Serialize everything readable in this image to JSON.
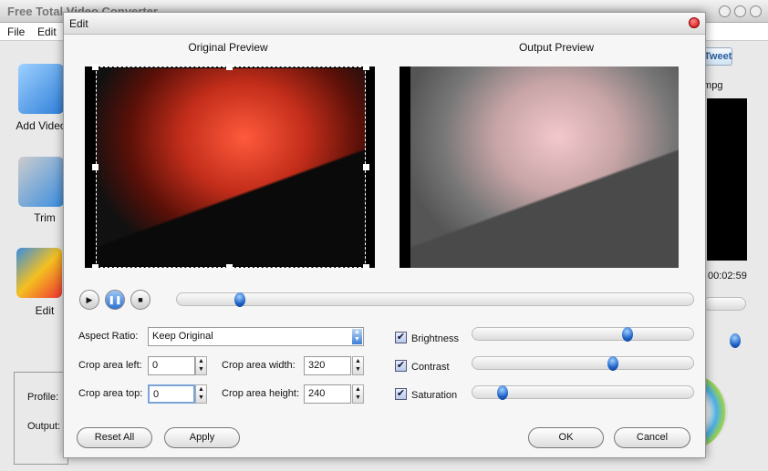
{
  "main_window": {
    "title": "Free Total Video Converter",
    "menu": [
      "File",
      "Edit"
    ],
    "sidebar": [
      {
        "label": "Add Video",
        "icon": "add-video-icon"
      },
      {
        "label": "Trim",
        "icon": "scissors-film-icon"
      },
      {
        "label": "Edit",
        "icon": "edit-film-icon"
      }
    ],
    "tweet_label": "Tweet",
    "file_ext": ".mpg",
    "duration": "00:02:59",
    "profile_label": "Profile:",
    "output_label": "Output:"
  },
  "dialog": {
    "title": "Edit",
    "original_preview_label": "Original Preview",
    "output_preview_label": "Output Preview",
    "seek_position": 0.11,
    "aspect_ratio_label": "Aspect Ratio:",
    "aspect_ratio_value": "Keep Original",
    "crop_left_label": "Crop area left:",
    "crop_left_value": "0",
    "crop_top_label": "Crop area top:",
    "crop_top_value": "0",
    "crop_width_label": "Crop area width:",
    "crop_width_value": "320",
    "crop_height_label": "Crop area height:",
    "crop_height_value": "240",
    "adjustments": [
      {
        "label": "Brightness",
        "checked": true,
        "value": 0.71
      },
      {
        "label": "Contrast",
        "checked": true,
        "value": 0.64
      },
      {
        "label": "Saturation",
        "checked": true,
        "value": 0.11
      }
    ],
    "buttons": {
      "reset": "Reset All",
      "apply": "Apply",
      "ok": "OK",
      "cancel": "Cancel"
    }
  }
}
